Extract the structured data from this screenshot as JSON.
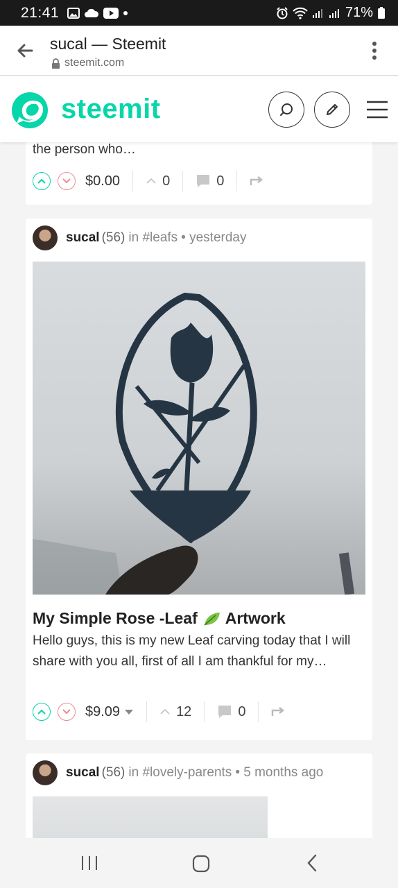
{
  "status_bar": {
    "time": "21:41",
    "battery": "71%"
  },
  "browser": {
    "title": "sucal — Steemit",
    "url": "steemit.com"
  },
  "site": {
    "brand": "steemit",
    "accent": "#06d6a9"
  },
  "posts": [
    {
      "excerpt": "the person who…",
      "payout": "$0.00",
      "votes": "0",
      "comments": "0"
    },
    {
      "author": "sucal",
      "reputation": "(56)",
      "community": "in #leafs",
      "time": "• yesterday",
      "title_part1": "My Simple Rose -Leaf",
      "title_part2": "Artwork",
      "excerpt": "Hello guys, this is my new Leaf carving today that I will share with you all, first of all I am thankful for my…",
      "payout": "$9.09",
      "votes": "12",
      "comments": "0"
    },
    {
      "author": "sucal",
      "reputation": "(56)",
      "community": "in #lovely-parents",
      "time": "• 5 months ago"
    }
  ]
}
